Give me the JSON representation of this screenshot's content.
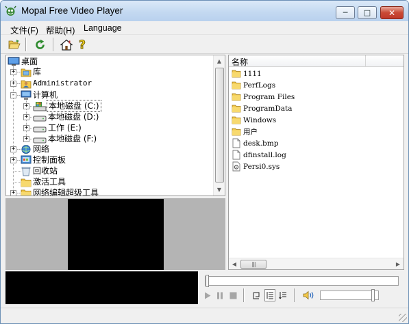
{
  "window": {
    "title": "Mopal Free Video Player",
    "minimize_glyph": "─",
    "maximize_glyph": "□",
    "close_glyph": "✕"
  },
  "menu": {
    "items": [
      "文件(F)",
      "帮助(H)",
      "Language"
    ]
  },
  "toolbar": {
    "icons": [
      "open-folder-icon",
      "refresh-icon",
      "home-icon",
      "help-icon"
    ]
  },
  "tree": {
    "root": "桌面",
    "items": [
      {
        "label": "库",
        "icon": "library-icon",
        "depth": 1,
        "expander": "+"
      },
      {
        "label": "Administrator",
        "icon": "user-folder-icon",
        "depth": 1,
        "expander": "+"
      },
      {
        "label": "计算机",
        "icon": "computer-icon",
        "depth": 1,
        "expander": "-"
      },
      {
        "label": "本地磁盘 (C:)",
        "icon": "system-drive-icon",
        "depth": 2,
        "expander": "+"
      },
      {
        "label": "本地磁盘 (D:)",
        "icon": "drive-icon",
        "depth": 2,
        "expander": "+"
      },
      {
        "label": "工作 (E:)",
        "icon": "drive-icon",
        "depth": 2,
        "expander": "+"
      },
      {
        "label": "本地磁盘 (F:)",
        "icon": "drive-icon",
        "depth": 2,
        "expander": "+"
      },
      {
        "label": "网络",
        "icon": "network-icon",
        "depth": 1,
        "expander": "+"
      },
      {
        "label": "控制面板",
        "icon": "control-panel-icon",
        "depth": 1,
        "expander": "+"
      },
      {
        "label": "回收站",
        "icon": "recycle-bin-icon",
        "depth": 1,
        "expander": ""
      },
      {
        "label": "激活工具",
        "icon": "folder-icon",
        "depth": 1,
        "expander": ""
      },
      {
        "label": "网络编辑超级工具",
        "icon": "folder-icon",
        "depth": 1,
        "expander": "+"
      }
    ]
  },
  "file_list": {
    "column_header": "名称",
    "files": [
      {
        "name": "1111",
        "icon": "folder-icon"
      },
      {
        "name": "PerfLogs",
        "icon": "folder-icon"
      },
      {
        "name": "Program Files",
        "icon": "folder-icon"
      },
      {
        "name": "ProgramData",
        "icon": "folder-icon"
      },
      {
        "name": "Windows",
        "icon": "folder-icon"
      },
      {
        "name": "用户",
        "icon": "folder-icon"
      },
      {
        "name": "desk.bmp",
        "icon": "file-icon"
      },
      {
        "name": "dfinstall.log",
        "icon": "file-icon"
      },
      {
        "name": "Persi0.sys",
        "icon": "system-file-icon"
      }
    ]
  },
  "player": {
    "controls": [
      "play-button",
      "pause-button",
      "stop-button",
      "repeat-button",
      "playlist-button",
      "playlist-sequence-button"
    ],
    "volume_level": 0.95,
    "seek_position": 0.0
  },
  "colors": {
    "folder": "#f3c94b",
    "accent": "#3a7bd5"
  }
}
